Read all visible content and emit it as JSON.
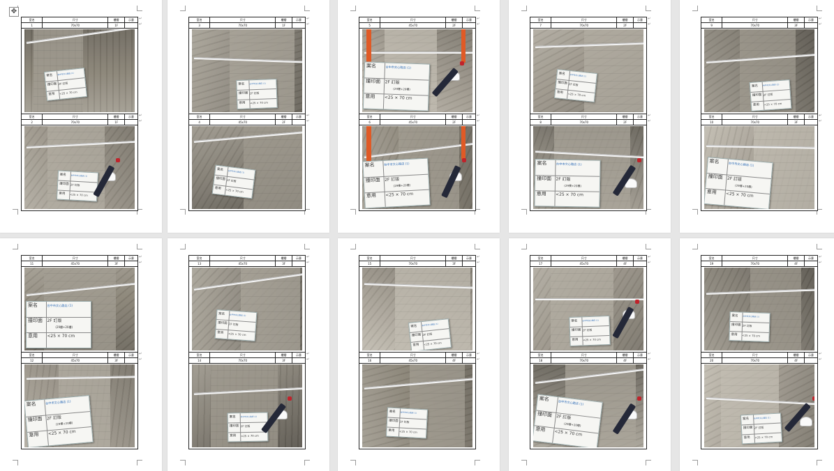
{
  "document": {
    "move_handle_icon": "four-arrow-move-icon",
    "paragraph_mark": "↵",
    "header_labels": [
      "室名",
      "尺寸",
      "樓層",
      "示意"
    ],
    "board_text": {
      "row1": "案名",
      "row1_value": "台中市文心路店 (1)",
      "row2": "撞印面",
      "row2_value": "2F 訂版",
      "row2_sub": "(29樓+20樓)",
      "row3": "意用",
      "row3_value": "<25 × 70 cm"
    }
  },
  "pages": [
    {
      "cards": [
        {
          "room": "1",
          "size": "70x70",
          "floor": "1F"
        },
        {
          "room": "2",
          "size": "70x70",
          "floor": "1F"
        }
      ]
    },
    {
      "cards": [
        {
          "room": "3",
          "size": "70x70",
          "floor": "1F"
        },
        {
          "room": "4",
          "size": "45x70",
          "floor": "2F"
        }
      ]
    },
    {
      "cards": [
        {
          "room": "5",
          "size": "45x70",
          "floor": "2F"
        },
        {
          "room": "6",
          "size": "45x70",
          "floor": "2F"
        }
      ]
    },
    {
      "cards": [
        {
          "room": "7",
          "size": "70x70",
          "floor": "2F"
        },
        {
          "room": "8",
          "size": "70x70",
          "floor": "2F"
        }
      ]
    },
    {
      "cards": [
        {
          "room": "9",
          "size": "70x70",
          "floor": "3F"
        },
        {
          "room": "10",
          "size": "70x70",
          "floor": "3F"
        }
      ]
    },
    {
      "cards": [
        {
          "room": "11",
          "size": "45x70",
          "floor": "3F"
        },
        {
          "room": "12",
          "size": "45x70",
          "floor": "3F"
        }
      ]
    },
    {
      "cards": [
        {
          "room": "13",
          "size": "45x70",
          "floor": "3F"
        },
        {
          "room": "14",
          "size": "70x70",
          "floor": "3F"
        }
      ]
    },
    {
      "cards": [
        {
          "room": "15",
          "size": "70x70",
          "floor": "3F"
        },
        {
          "room": "16",
          "size": "45x70",
          "floor": "4F"
        }
      ]
    },
    {
      "cards": [
        {
          "room": "17",
          "size": "45x70",
          "floor": "4F"
        },
        {
          "room": "18",
          "size": "70x70",
          "floor": "4F"
        }
      ]
    },
    {
      "cards": [
        {
          "room": "19",
          "size": "70x70",
          "floor": "4F"
        },
        {
          "room": "20",
          "size": "70x70",
          "floor": "4F"
        }
      ]
    }
  ]
}
